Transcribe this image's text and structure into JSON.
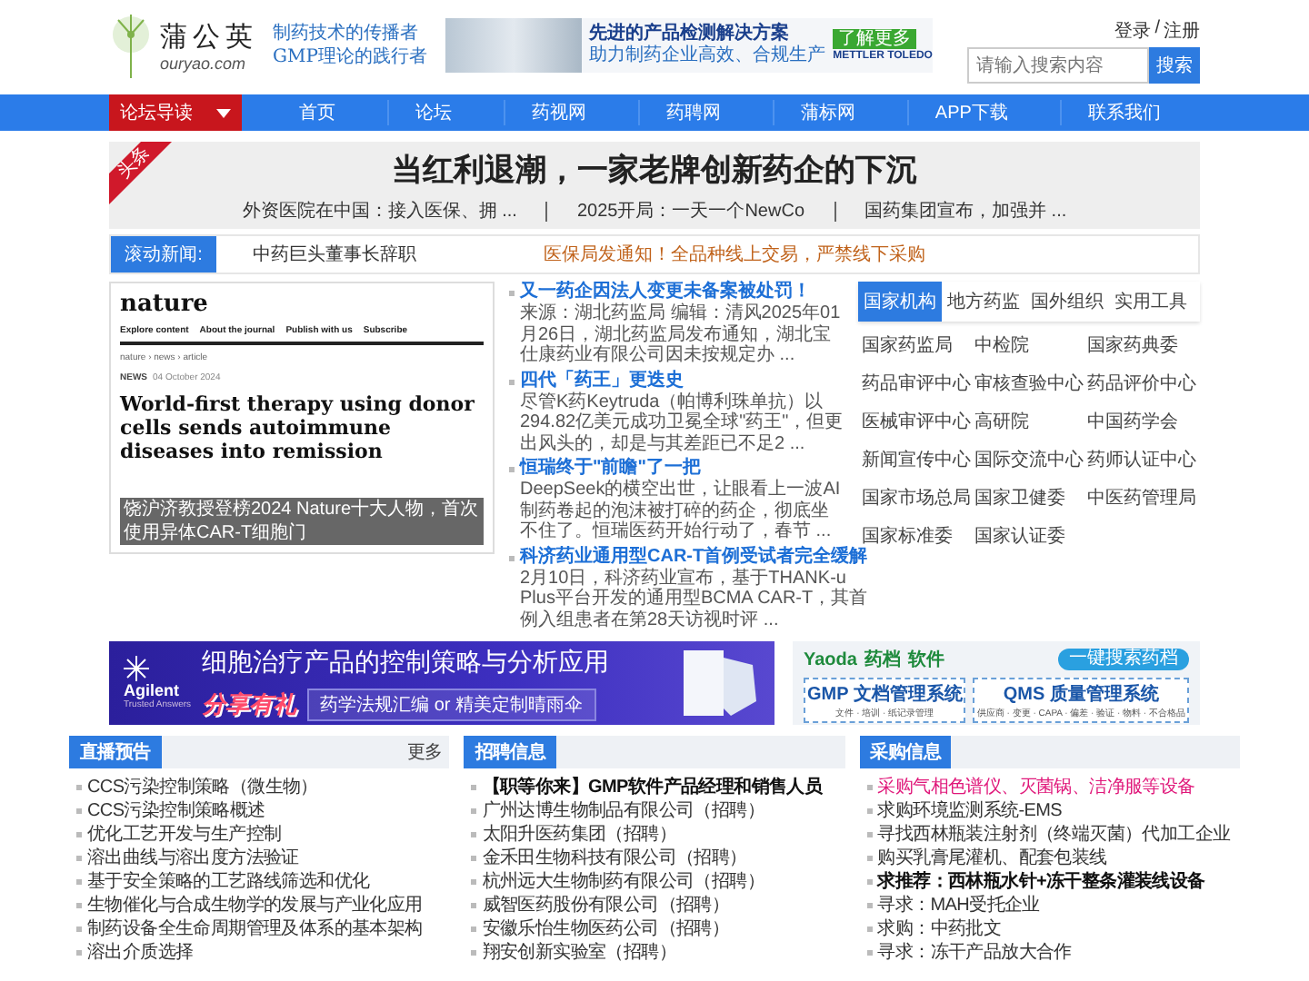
{
  "header": {
    "logo": {
      "name": "蒲公英",
      "domain": "ouryao.com"
    },
    "slogans": [
      "制药技术的传播者",
      "GMP理论的践行者"
    ],
    "ad": {
      "title": "先进的产品检测解决方案",
      "subtitle": "助力制药企业高效、合规生产",
      "button": "了解更多",
      "brand": "METTLER TOLEDO"
    },
    "account": {
      "login": "登录",
      "separator": "/",
      "register": "注册"
    },
    "search": {
      "placeholder": "请输入搜索内容",
      "button": "搜索"
    }
  },
  "nav": {
    "guide": "论坛导读",
    "items": [
      "首页",
      "论坛",
      "药视网",
      "药聘网",
      "蒲标网",
      "APP下载",
      "联系我们"
    ]
  },
  "headline": {
    "badge": "头条",
    "title": "当红利退潮，一家老牌创新药企的下沉",
    "links": [
      "外资医院在中国：接入医保、拥 ...",
      "2025开局：一天一个NewCo",
      "国药集团宣布，加强并 ..."
    ]
  },
  "ticker": {
    "label": "滚动新闻:",
    "items": [
      {
        "text": "中药巨头董事长辞职",
        "color": "#333333"
      },
      {
        "text": "医保局发通知！全品种线上交易，严禁线下采购",
        "color": "#c0621a"
      }
    ]
  },
  "feature": {
    "site": "nature",
    "menu": [
      "Explore content",
      "About the journal",
      "Publish with us",
      "Subscribe"
    ],
    "breadcrumb": "nature › news › article",
    "section": "NEWS",
    "date": "04 October 2024",
    "title": "World-first therapy using donor cells sends autoimmune diseases into remission",
    "caption": "饶沪济教授登榜2024 Nature十大人物，首次使用异体CAR-T细胞门"
  },
  "news": [
    {
      "title": "又一药企因法人变更未备案被处罚！",
      "summary": "来源：湖北药监局 编辑：清风2025年01月26日，湖北药监局发布通知，湖北宝仕康药业有限公司因未按规定办 ..."
    },
    {
      "title": "四代「药王」更迭史",
      "summary": "尽管K药Keytruda（帕博利珠单抗）以294.82亿美元成功卫冕全球\"药王\"，但更出风头的，却是与其差距已不足2 ..."
    },
    {
      "title": "恒瑞终于\"前瞻\"了一把",
      "summary": "DeepSeek的横空出世，让眼看上一波AI制药卷起的泡沫被打碎的药企，彻底坐不住了。恒瑞医药开始行动了，春节 ..."
    },
    {
      "title": "科济药业通用型CAR-T首例受试者完全缓解",
      "summary": "2月10日，科济药业宣布，基于THANK-u Plus平台开发的通用型BCMA CAR-T，其首例入组患者在第28天访视时评 ..."
    }
  ],
  "directory": {
    "tabs": [
      {
        "label": "国家机构",
        "selected": true
      },
      {
        "label": "地方药监",
        "selected": false
      },
      {
        "label": "国外组织",
        "selected": false
      },
      {
        "label": "实用工具",
        "selected": false
      }
    ],
    "links": [
      "国家药监局",
      "中检院",
      "国家药典委",
      "药品审评中心",
      "审核查验中心",
      "药品评价中心",
      "医械审评中心",
      "高研院",
      "中国药学会",
      "新闻宣传中心",
      "国际交流中心",
      "药师认证中心",
      "国家市场总局",
      "国家卫健委",
      "中医药管理局",
      "国家标准委",
      "国家认证委"
    ]
  },
  "banners": {
    "agilent": {
      "brand": "Agilent",
      "tagline": "Trusted Answers",
      "title": "细胞治疗产品的控制策略与分析应用",
      "promo": "分享有礼",
      "offer": "药学法规汇编 or 精美定制晴雨伞"
    },
    "yaoda": {
      "brand": "Yaoda",
      "brand_cn": "药档",
      "product": "软件",
      "button": "一键搜索药档",
      "cards": [
        {
          "title": "GMP 文档管理系统",
          "detail": "文件 · 培训 · 纸记录管理"
        },
        {
          "title": "QMS 质量管理系统",
          "detail": "供应商 · 变更 · CAPA · 偏差 · 验证 · 物料 · 不合格品"
        }
      ]
    }
  },
  "sections": [
    {
      "title": "直播预告",
      "more": "更多",
      "items": [
        {
          "text": "CCS污染控制策略（微生物）",
          "kind": "normal"
        },
        {
          "text": "CCS污染控制策略概述",
          "kind": "normal"
        },
        {
          "text": "优化工艺开发与生产控制",
          "kind": "normal"
        },
        {
          "text": "溶出曲线与溶出度方法验证",
          "kind": "normal"
        },
        {
          "text": "基于安全策略的工艺路线筛选和优化",
          "kind": "normal"
        },
        {
          "text": "生物催化与合成生物学的发展与产业化应用",
          "kind": "normal"
        },
        {
          "text": "制药设备全生命周期管理及体系的基本架构",
          "kind": "normal"
        },
        {
          "text": "溶出介质选择",
          "kind": "normal"
        }
      ]
    },
    {
      "title": "招聘信息",
      "items": [
        {
          "text": "【职等你来】GMP软件产品经理和销售人员",
          "kind": "bold"
        },
        {
          "text": "广州达博生物制品有限公司（招聘）",
          "kind": "normal"
        },
        {
          "text": "太阳升医药集团（招聘）",
          "kind": "normal"
        },
        {
          "text": "金禾田生物科技有限公司（招聘）",
          "kind": "normal"
        },
        {
          "text": "杭州远大生物制药有限公司（招聘）",
          "kind": "normal"
        },
        {
          "text": "威智医药股份有限公司（招聘）",
          "kind": "normal"
        },
        {
          "text": "安徽乐怡生物医药公司（招聘）",
          "kind": "normal"
        },
        {
          "text": "翔安创新实验室（招聘）",
          "kind": "normal"
        }
      ]
    },
    {
      "title": "采购信息",
      "items": [
        {
          "text": "采购气相色谱仪、灭菌锅、洁净服等设备",
          "kind": "highlight"
        },
        {
          "text": "求购环境监测系统-EMS",
          "kind": "normal"
        },
        {
          "text": "寻找西林瓶装注射剂（终端灭菌）代加工企业",
          "kind": "normal"
        },
        {
          "text": "购买乳膏尾灌机、配套包装线",
          "kind": "normal"
        },
        {
          "text": "求推荐：西林瓶水针+冻干整条灌装线设备",
          "kind": "bold"
        },
        {
          "text": "寻求：MAH受托企业",
          "kind": "normal"
        },
        {
          "text": "求购：中药批文",
          "kind": "normal"
        },
        {
          "text": "寻求：冻干产品放大合作",
          "kind": "normal"
        }
      ]
    }
  ]
}
